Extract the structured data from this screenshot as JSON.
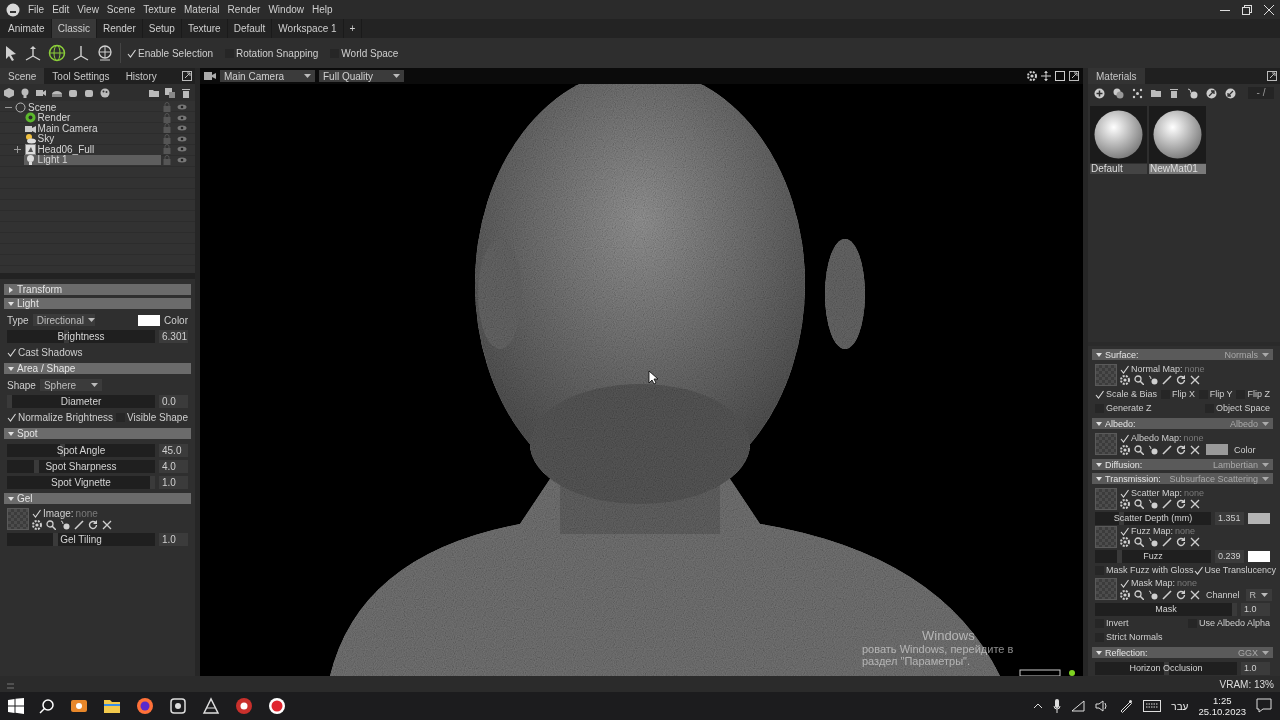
{
  "menu": {
    "items": [
      "File",
      "Edit",
      "View",
      "Scene",
      "Texture",
      "Material",
      "Render",
      "Window",
      "Help"
    ]
  },
  "workspace_tabs": [
    {
      "label": "Animate",
      "selected": false
    },
    {
      "label": "Classic",
      "selected": true
    },
    {
      "label": "Render",
      "selected": false
    },
    {
      "label": "Setup",
      "selected": false
    },
    {
      "label": "Texture",
      "selected": false
    },
    {
      "label": "Default",
      "selected": false
    },
    {
      "label": "Workspace 1",
      "selected": false
    },
    {
      "label": "+",
      "selected": false
    }
  ],
  "toolbar": {
    "tools": [
      {
        "kind": "select",
        "selected": false
      },
      {
        "kind": "move",
        "selected": false
      },
      {
        "kind": "rotate",
        "selected": true
      },
      {
        "kind": "scale",
        "selected": false
      },
      {
        "kind": "lamp",
        "selected": false
      }
    ],
    "options": [
      {
        "label": "Enable Selection",
        "checked": true
      },
      {
        "label": "Rotation Snapping",
        "checked": false
      },
      {
        "label": "World Space",
        "checked": false
      }
    ]
  },
  "left_panel": {
    "tabs": [
      {
        "label": "Scene",
        "selected": true
      },
      {
        "label": "Tool Settings",
        "selected": false
      },
      {
        "label": "History",
        "selected": false
      }
    ],
    "tree": [
      {
        "label": "Scene",
        "kind": "scene",
        "selected": false,
        "expanded": true,
        "children": [
          {
            "label": "Render",
            "kind": "render",
            "selected": false
          },
          {
            "label": "Main Camera",
            "kind": "camera",
            "selected": false
          },
          {
            "label": "Sky",
            "kind": "sky",
            "selected": false
          },
          {
            "label": "Head06_Full",
            "kind": "mesh",
            "selected": false,
            "expanded": false
          },
          {
            "label": "Light 1",
            "kind": "light",
            "selected": true
          }
        ]
      }
    ],
    "properties": [
      {
        "kind": "section",
        "label": "Transform",
        "expanded": false
      },
      {
        "kind": "section",
        "label": "Light",
        "expanded": true
      },
      {
        "kind": "select",
        "label": "Type",
        "value": "Directional",
        "color": "#ffffff",
        "color_label": "Color"
      },
      {
        "kind": "slider",
        "label": "Brightness",
        "value": "6.301",
        "level": 0.4
      },
      {
        "kind": "checks",
        "items": [
          {
            "label": "Cast Shadows",
            "checked": true
          }
        ]
      },
      {
        "kind": "section",
        "label": "Area / Shape",
        "expanded": true
      },
      {
        "kind": "select",
        "label": "Shape",
        "value": "Sphere"
      },
      {
        "kind": "slider",
        "label": "Diameter",
        "value": "0.0",
        "level": 0
      },
      {
        "kind": "checks",
        "items": [
          {
            "label": "Normalize Brightness",
            "checked": true
          },
          {
            "label": "Visible Shape",
            "checked": false
          }
        ]
      },
      {
        "kind": "section",
        "label": "Spot",
        "expanded": true
      },
      {
        "kind": "slider",
        "label": "Spot Angle",
        "value": "45.0",
        "level": 0.37
      },
      {
        "kind": "slider",
        "label": "Spot Sharpness",
        "value": "4.0",
        "level": 0.19
      },
      {
        "kind": "slider",
        "label": "Spot Vignette",
        "value": "1.0",
        "level": 1
      },
      {
        "kind": "section",
        "label": "Gel",
        "expanded": true
      },
      {
        "kind": "map",
        "label": "Image:",
        "status": "none",
        "enabled": true
      },
      {
        "kind": "slider",
        "label": "Gel Tiling",
        "value": "1.0",
        "level": 0.32
      }
    ]
  },
  "viewport": {
    "camera": "Main Camera",
    "quality": "Full Quality"
  },
  "materials": {
    "tab": "Materials",
    "page": "- /",
    "items": [
      {
        "name": "Default",
        "selected": false
      },
      {
        "name": "NewMat01",
        "selected": true
      }
    ],
    "properties": [
      {
        "kind": "section",
        "label": "Surface:",
        "value": "Normals",
        "expanded": true
      },
      {
        "kind": "map",
        "label": "Normal Map:",
        "status": "none",
        "enabled": true
      },
      {
        "kind": "checks",
        "items": [
          {
            "label": "Scale & Bias",
            "checked": true
          },
          {
            "label": "Flip X",
            "checked": false
          },
          {
            "label": "Flip Y",
            "checked": false
          },
          {
            "label": "Flip Z",
            "checked": false
          }
        ]
      },
      {
        "kind": "checks",
        "items": [
          {
            "label": "Generate Z",
            "checked": false
          },
          {
            "label": "Object Space",
            "checked": false
          }
        ]
      },
      {
        "kind": "section",
        "label": "Albedo:",
        "value": "Albedo",
        "expanded": true
      },
      {
        "kind": "map",
        "label": "Albedo Map:",
        "status": "none",
        "enabled": true,
        "color": "#9a9a9a",
        "color_label": "Color"
      },
      {
        "kind": "section",
        "label": "Diffusion:",
        "value": "Lambertian",
        "expanded": true
      },
      {
        "kind": "section",
        "label": "Transmission:",
        "value": "Subsurface Scattering",
        "expanded": true
      },
      {
        "kind": "map",
        "label": "Scatter Map:",
        "status": "none",
        "enabled": true
      },
      {
        "kind": "slider",
        "label": "Scatter Depth (mm)",
        "value": "1.351",
        "level": 0.22,
        "color": "#b4b4b4"
      },
      {
        "kind": "map",
        "label": "Fuzz Map:",
        "status": "none",
        "enabled": true
      },
      {
        "kind": "slider",
        "label": "Fuzz",
        "value": "0.239",
        "level": 0.2,
        "color": "#ffffff"
      },
      {
        "kind": "checks",
        "items": [
          {
            "label": "Mask Fuzz with Gloss",
            "checked": false
          },
          {
            "label": "Use Translucency",
            "checked": true
          }
        ]
      },
      {
        "kind": "map",
        "label": "Mask Map:",
        "status": "none",
        "enabled": true,
        "channel_label": "Channel",
        "channel": "R"
      },
      {
        "kind": "slider",
        "label": "Mask",
        "value": "1.0",
        "level": 1
      },
      {
        "kind": "checks",
        "items": [
          {
            "label": "Invert",
            "checked": false
          },
          {
            "label": "Use Albedo Alpha",
            "checked": false
          }
        ]
      },
      {
        "kind": "checks",
        "items": [
          {
            "label": "Strict Normals",
            "checked": false
          }
        ]
      },
      {
        "kind": "section",
        "label": "Reflection:",
        "value": "GGX",
        "expanded": true
      },
      {
        "kind": "slider",
        "label": "Horizon Occlusion",
        "value": "1.0",
        "level": 0.5
      }
    ]
  },
  "activation_notice": {
    "title": "Windows",
    "text": "ровать Windows, перейдите в раздел \"Параметры\"."
  },
  "status_bar": {
    "vram": "VRAM: 13%"
  },
  "taskbar": {
    "language": "עבר",
    "time": "1:25",
    "date": "25.10.2023"
  }
}
